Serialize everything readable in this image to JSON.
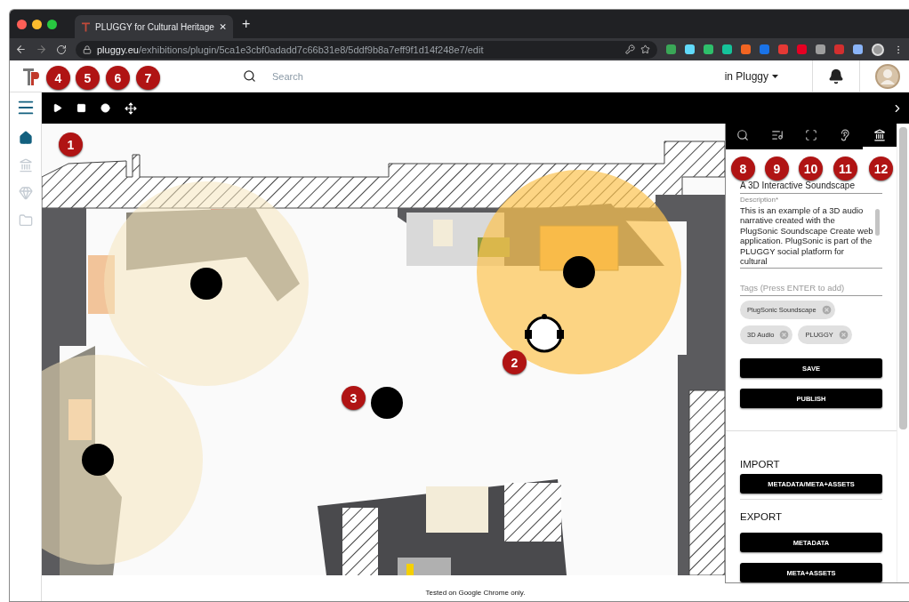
{
  "browser": {
    "tab_title": "PLUGGY for Cultural Heritage",
    "new_tab": "+",
    "url_host": "pluggy.eu",
    "url_path": "/exhibitions/plugin/5ca1e3cbf0adadd7c66b31e8/5ddf9b8a7eff9f1d14f248e7/edit"
  },
  "header": {
    "search_placeholder": "Search",
    "scope_menu": "in Pluggy"
  },
  "sidebar": {
    "items": [
      {
        "kind": "home",
        "selected": true
      },
      {
        "kind": "museum",
        "selected": false
      },
      {
        "kind": "gem",
        "selected": false
      },
      {
        "kind": "folder",
        "selected": false
      }
    ]
  },
  "toolbar": {
    "buttons": [
      {
        "kind": "play"
      },
      {
        "kind": "stop"
      },
      {
        "kind": "record"
      },
      {
        "kind": "move"
      }
    ]
  },
  "panel": {
    "tabs": [
      {
        "kind": "search",
        "selected": false
      },
      {
        "kind": "playlist",
        "selected": false
      },
      {
        "kind": "frame",
        "selected": false
      },
      {
        "kind": "ear",
        "selected": false
      },
      {
        "kind": "museum",
        "selected": true
      }
    ],
    "title_value": "A 3D Interactive Soundscape",
    "description_label": "Description*",
    "description": "This is an example of a 3D audio narrative created with the PlugSonic Soundscape Create web application. PlugSonic is part of the PLUGGY social platform for cultural",
    "tags_placeholder": "Tags (Press ENTER to add)",
    "tags": [
      "PlugSonic Soundscape",
      "3D Audio",
      "PLUGGY"
    ],
    "buttons": [
      "SAVE",
      "PUBLISH"
    ],
    "import_heading": "IMPORT",
    "import_buttons": [
      "METADATA/META+ASSETS"
    ],
    "export_heading": "EXPORT",
    "export_buttons": [
      "METADATA",
      "META+ASSETS"
    ]
  },
  "callouts": [
    "1",
    "2",
    "3",
    "4",
    "5",
    "6",
    "7",
    "8",
    "9",
    "10",
    "11",
    "12"
  ],
  "footer": "Tested on Google Chrome only."
}
